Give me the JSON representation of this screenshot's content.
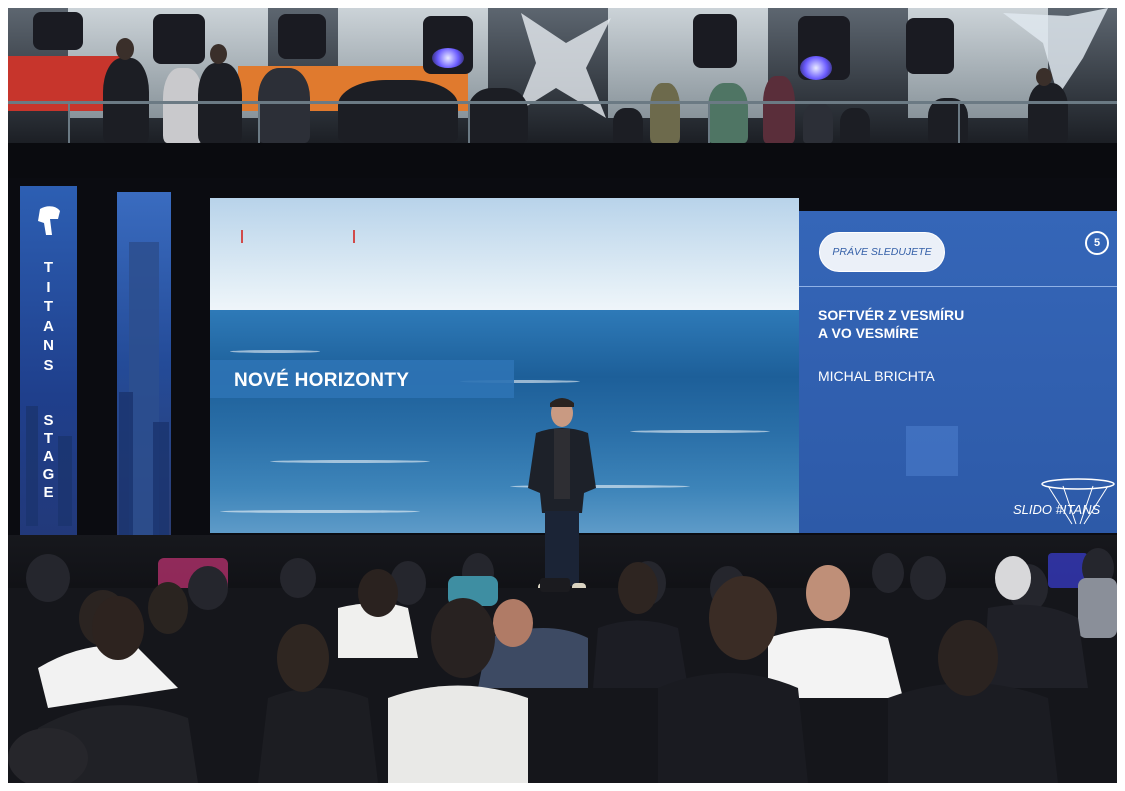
{
  "photo": {
    "description_type": "event-stage-photo",
    "colors": {
      "screen_blue": "#2d5aa8",
      "sea": "#1d5f99",
      "banner": "#2e73b4"
    }
  },
  "pillar": {
    "titans_letters": [
      "T",
      "I",
      "T",
      "A",
      "N",
      "S"
    ],
    "stage_letters": [
      "S",
      "T",
      "A",
      "G",
      "E"
    ]
  },
  "main_screen": {
    "banner_text": "NOVÉ HORIZONTY"
  },
  "side_panel": {
    "pill_text": "PRÁVE SLEDUJETE",
    "badge_number": "5",
    "talk_title_line1": "SOFTVÉR Z VESMÍRU",
    "talk_title_line2": "A VO VESMÍRE",
    "speaker_name": "MICHAL BRICHTA",
    "hashtag": "SLIDO #ITANS"
  }
}
